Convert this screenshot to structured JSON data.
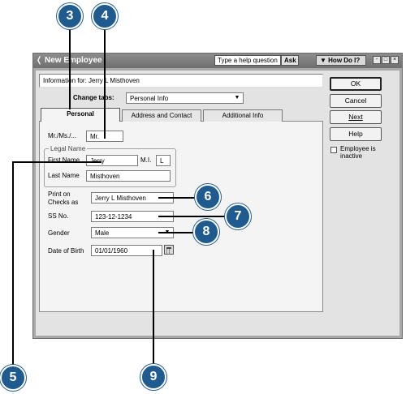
{
  "window": {
    "title": "New Employee",
    "help_placeholder": "Type a help question",
    "ask_label": "Ask",
    "howdo_label": "How Do I?",
    "controls": [
      "-",
      "□",
      "×"
    ]
  },
  "info": {
    "text": "Information for: Jerry L Misthoven"
  },
  "change_tabs": {
    "label": "Change tabs:",
    "value": "Personal Info"
  },
  "tabs": [
    {
      "label": "Personal",
      "active": true
    },
    {
      "label": "Address and Contact",
      "active": false
    },
    {
      "label": "Additional Info",
      "active": false
    }
  ],
  "form": {
    "salutation": {
      "label": "Mr./Ms./...",
      "value": "Mr."
    },
    "legal_name_legend": "Legal Name",
    "first_name": {
      "label": "First Name",
      "value": "Jerry"
    },
    "mi": {
      "label": "M.I.",
      "value": "L"
    },
    "last_name": {
      "label": "Last Name",
      "value": "Misthoven"
    },
    "print_on_checks": {
      "label_line1": "Print on",
      "label_line2": "Checks as",
      "value": "Jerry L Misthoven"
    },
    "ssn": {
      "label": "SS No.",
      "value": "123-12-1234"
    },
    "gender": {
      "label": "Gender",
      "value": "Male"
    },
    "dob": {
      "label": "Date of Birth",
      "value": "01/01/1960"
    }
  },
  "buttons": {
    "ok": "OK",
    "cancel": "Cancel",
    "next": "Next",
    "help": "Help"
  },
  "inactive": {
    "label_line1": "Employee is",
    "label_line2": "inactive",
    "checked": false
  },
  "callouts": {
    "c3": "3",
    "c4": "4",
    "c5": "5",
    "c6": "6",
    "c7": "7",
    "c8": "8",
    "c9": "9"
  },
  "colors": {
    "callout": "#1f5b8f",
    "titlebar": "#7a7a7a",
    "dialog": "#e3e3e3"
  }
}
